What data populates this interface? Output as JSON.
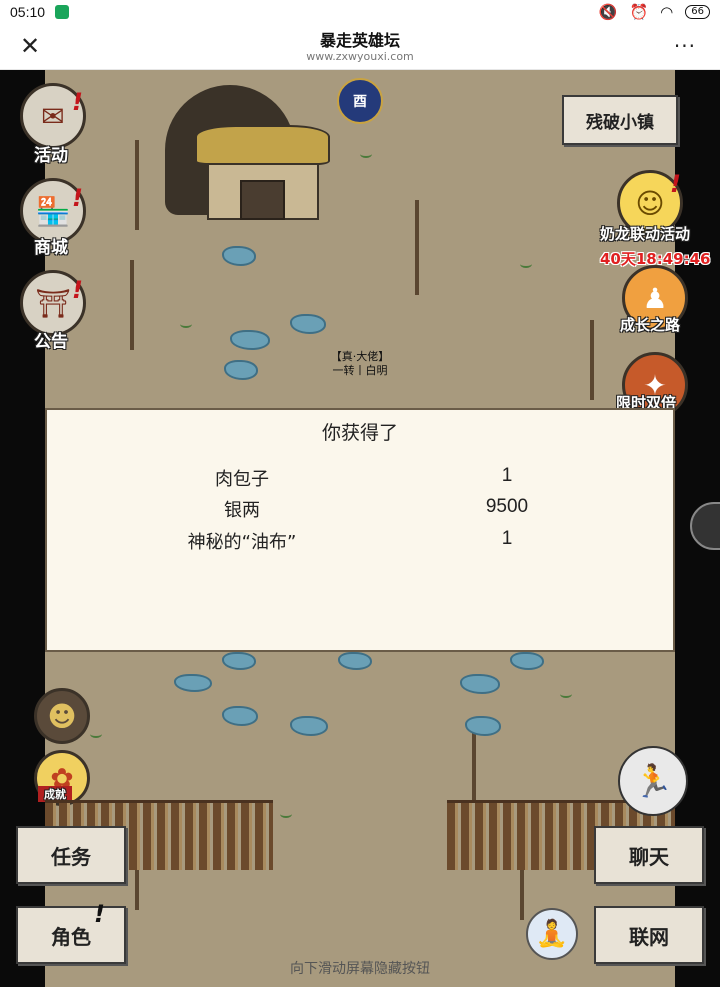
{
  "status_bar": {
    "time": "05:10",
    "battery": "66"
  },
  "header": {
    "title": "暴走英雄坛",
    "url": "www.zxwyouxi.com",
    "close_glyph": "✕",
    "more_glyph": "···"
  },
  "left_icons": [
    {
      "label": "活动",
      "icon": "event-scroll-icon"
    },
    {
      "label": "商城",
      "icon": "shop-icon"
    },
    {
      "label": "公告",
      "icon": "notice-icon"
    }
  ],
  "moon_icon_text": "酉",
  "right_panel": {
    "town_button": "残破小镇",
    "event1_label": "奶龙联动活动",
    "event1_timer": "40天18:49:46",
    "event2_label": "成长之路",
    "event3_label": "限时双倍"
  },
  "player": {
    "title": "【真·大佬】",
    "subtitle": "一转丨白明"
  },
  "dialog": {
    "title": "你获得了",
    "rewards": [
      {
        "name": "肉包子",
        "qty": "1"
      },
      {
        "name": "银两",
        "qty": "9500"
      },
      {
        "name": "神秘的“油布”",
        "qty": "1"
      }
    ]
  },
  "bottom_left": {
    "task_button": "任务",
    "role_button": "角色"
  },
  "bottom_right": {
    "chat_button": "聊天",
    "network_button": "联网"
  },
  "badge_text": "成就",
  "hint": "向下滑动屏幕隐藏按钮",
  "colors": {
    "ground": "#a89a7e",
    "timer_red": "#e02020",
    "alert_red": "#c4151c"
  }
}
